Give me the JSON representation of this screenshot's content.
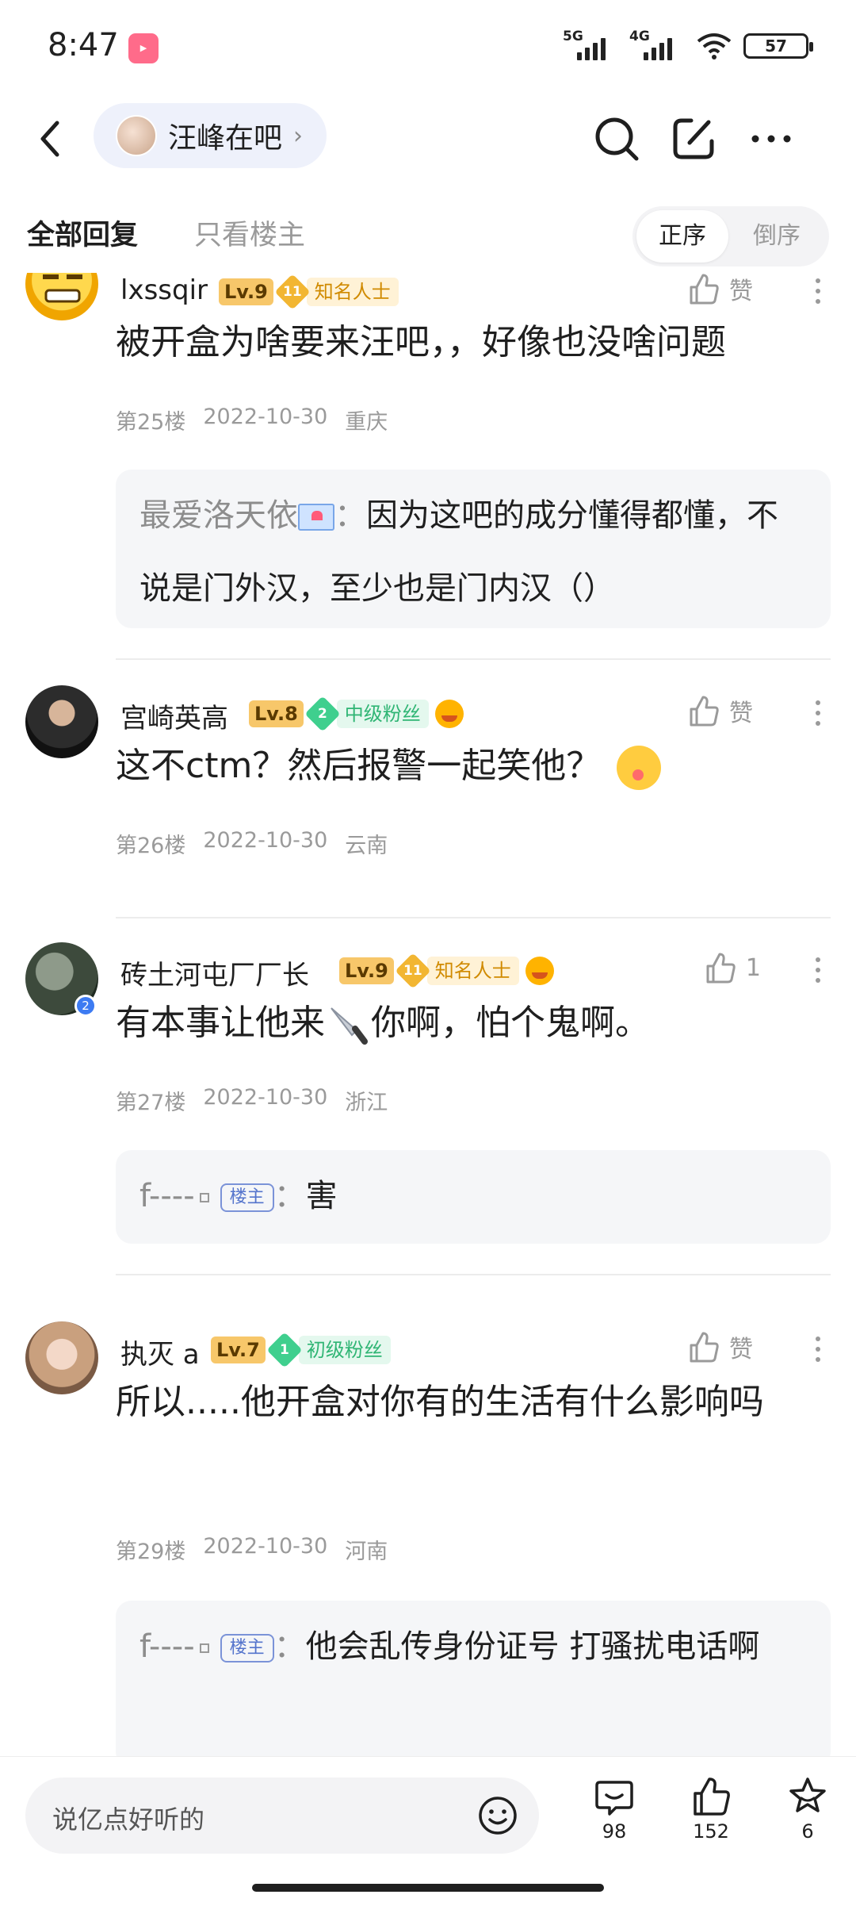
{
  "status": {
    "time": "8:47",
    "net1": "5G",
    "net2": "4G",
    "battery": "57",
    "app_icon": "bilibili-style-icon"
  },
  "header": {
    "forum_name": "汪峰在吧",
    "chevron": "›"
  },
  "tabs": {
    "all": "全部回复",
    "lz_only": "只看楼主",
    "sort_asc": "正序",
    "sort_desc": "倒序"
  },
  "posts": [
    {
      "username": "lxssqir",
      "level": "Lv.9",
      "gem_level": "11",
      "title": "知名人士",
      "like": "赞",
      "text": "被开盒为啥要来汪吧，，好像也没啥问题",
      "floor": "第25楼",
      "date": "2022-10-30",
      "location": "重庆",
      "reply": {
        "user": "最爱洛天依",
        "sep": "：",
        "text": "因为这吧的成分懂得都懂，不说是门外汉，至少也是门内汉（）"
      }
    },
    {
      "username": "宫崎英高",
      "level": "Lv.8",
      "gem_level": "2",
      "title": "中级粉丝",
      "like": "赞",
      "text": "这不ctm？然后报警一起笑他？",
      "floor": "第26楼",
      "date": "2022-10-30",
      "location": "云南"
    },
    {
      "username": "砖土河屯厂厂长",
      "level": "Lv.9",
      "gem_level": "11",
      "title": "知名人士",
      "like": "1",
      "text_a": "有本事让他来",
      "text_b": "你啊，怕个鬼啊。",
      "floor": "第27楼",
      "date": "2022-10-30",
      "location": "浙江",
      "reply": {
        "user": "f----",
        "tag": "楼主",
        "sep": "：",
        "text": "害"
      }
    },
    {
      "username": "执灭 a",
      "level": "Lv.7",
      "gem_level": "1",
      "title": "初级粉丝",
      "like": "赞",
      "text": "所以.....他开盒对你有的生活有什么影响吗",
      "floor": "第29楼",
      "date": "2022-10-30",
      "location": "河南",
      "reply": {
        "user": "f----",
        "tag": "楼主",
        "sep": "：",
        "text": "他会乱传身份证号 打骚扰电话啊"
      }
    }
  ],
  "bottom": {
    "placeholder": "说亿点好听的",
    "comments": "98",
    "likes": "152",
    "favorites": "6"
  },
  "colors": {
    "accent_blue": "#5474cc",
    "gold": "#f2b632",
    "green": "#3fcf8e",
    "chip_bg": "#eef1fb"
  }
}
